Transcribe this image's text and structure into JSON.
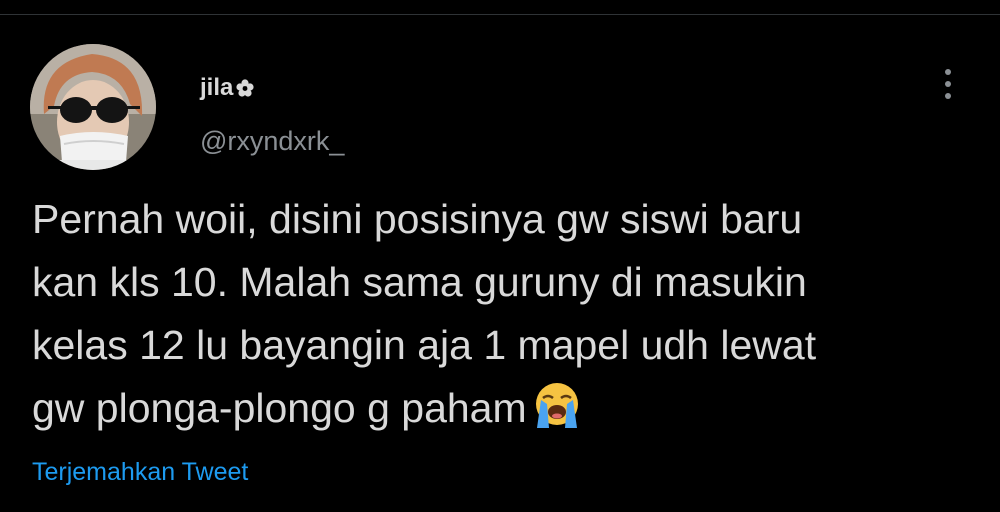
{
  "tweet": {
    "author": {
      "display_name": "jila",
      "name_icon": "flower-icon",
      "handle": "@rxyndxrk_",
      "avatar": "avatar-photo"
    },
    "text_lines": [
      "Pernah woii, disini posisinya gw siswi baru",
      "kan kls 10. Malah sama guruny di masukin",
      "kelas 12 lu bayangin aja 1 mapel udh lewat",
      "gw plonga-plongo g paham"
    ],
    "end_emoji": "loudly-crying-face-emoji",
    "translate_label": "Terjemahkan Tweet",
    "more_icon": "more-options-icon"
  },
  "colors": {
    "background": "#000000",
    "text": "#d9d9d9",
    "secondary_text": "#8b9095",
    "link": "#1d9bf0"
  }
}
